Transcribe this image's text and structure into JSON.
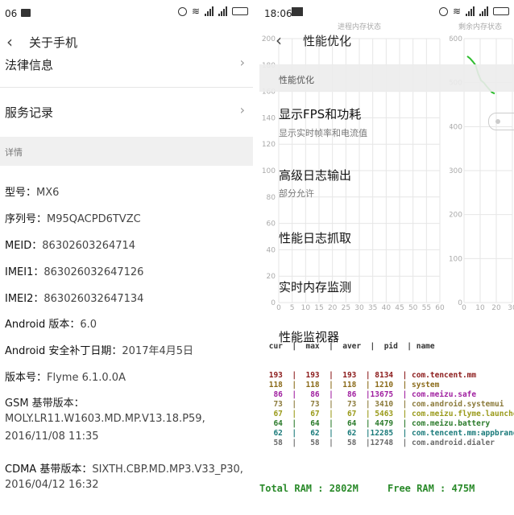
{
  "left": {
    "status": {
      "time": "06"
    },
    "title": "关于手机",
    "rows": [
      {
        "label": "法律信息"
      },
      {
        "label": "服务记录"
      }
    ],
    "section": "详情",
    "info": [
      {
        "k": "型号：",
        "v": "MX6"
      },
      {
        "k": "序列号：",
        "v": "M95QACPD6TVZC"
      },
      {
        "k": "MEID：",
        "v": "86302603264714"
      },
      {
        "k": "IMEI1：",
        "v": "863026032647126"
      },
      {
        "k": "IMEI2：",
        "v": "863026032647134"
      },
      {
        "k": "Android 版本：",
        "v": "6.0"
      },
      {
        "k": "Android 安全补丁日期：",
        "v": "2017年4月5日"
      },
      {
        "k": "版本号：",
        "v": "Flyme 6.1.0.0A"
      }
    ],
    "baseband": {
      "gsm_label": "GSM 基带版本：",
      "gsm_v1": "MOLY.LR11.W1603.MD.MP.V13.18.P59,",
      "gsm_v2": "2016/11/08 11:35",
      "cdma_label": "CDMA 基带版本：",
      "cdma_v1": "SIXTH.CBP.MD.MP3.V33_P30,",
      "cdma_v2": "2016/04/12 16:32"
    }
  },
  "right": {
    "status": {
      "time": "18:06"
    },
    "title": "性能优化",
    "chart1_title": "进程内存状态",
    "chart2_title": "剩余内存状态",
    "y1_ticks": [
      "200",
      "180",
      "160",
      "140",
      "120",
      "100",
      "80",
      "60",
      "40",
      "20",
      "0"
    ],
    "x1_ticks": [
      "0",
      "5",
      "10",
      "15",
      "20",
      "25",
      "30",
      "35",
      "40",
      "45",
      "50",
      "55",
      "60"
    ],
    "y2_ticks": [
      "600",
      "500",
      "400",
      "300",
      "200",
      "100",
      "0"
    ],
    "x2_ticks": [
      "0",
      "10",
      "20",
      "30"
    ],
    "menu": [
      {
        "label": "性能优化"
      },
      {
        "label": "显示FPS和功耗",
        "sub": "显示实时帧率和电流值"
      },
      {
        "label": "高级日志输出",
        "sub": "部分允许"
      },
      {
        "label": "性能日志抓取"
      },
      {
        "label": "实时内存监测"
      },
      {
        "label": "性能监视器"
      }
    ],
    "proc_header": " cur  |  max  |  aver  |  pid  | name",
    "proc_rows": [
      {
        "text": " 193  |  193  |  193  | 8134  | com.tencent.mm",
        "color": "#8b1a1a"
      },
      {
        "text": " 118  |  118  |  118  | 1210  | system",
        "color": "#8b6b1a"
      },
      {
        "text": "  86  |   86  |   86  |13675  | com.meizu.safe",
        "color": "#a020a0"
      },
      {
        "text": "  73  |   73  |   73  | 3410  | com.android.systemui",
        "color": "#8b7a3a"
      },
      {
        "text": "  67  |   67  |   67  | 5463  | com.meizu.flyme.launcher",
        "color": "#9a9a1a"
      },
      {
        "text": "  64  |   64  |   64  | 4479  | com.meizu.battery",
        "color": "#2a7a2a"
      },
      {
        "text": "  62  |   62  |   62  |12285  | com.tencent.mm:appbrand0",
        "color": "#1a7a7a"
      },
      {
        "text": "  58  |   58  |   58  |12748  | com.android.dialer",
        "color": "#6a6a6a"
      }
    ],
    "total_ram": "Total RAM : 2802M",
    "free_ram": "Free RAM : 475M",
    "free_series": [
      560,
      555,
      548,
      540,
      520,
      505,
      500,
      492,
      485,
      478,
      475
    ]
  }
}
